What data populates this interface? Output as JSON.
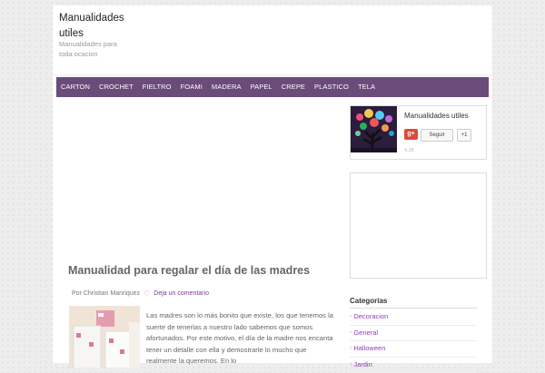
{
  "header": {
    "site_title": "Manualidades utiles",
    "site_description": "Manualidades para toda ocacion"
  },
  "nav": {
    "items": [
      "CARTON",
      "CROCHET",
      "FIELTRO",
      "FOAMI",
      "MADERA",
      "PAPEL",
      "CREPE",
      "PLASTICO",
      "TELA"
    ]
  },
  "post": {
    "title": "Manualidad para regalar el día de las madres",
    "author": "Por Christian Manriquez",
    "comment_link": "Deja un comentario",
    "excerpt": "Las madres son lo más bonito que existe, los que tenemos la suerte de tenerlas a nuestro lado sabemos que somos afortunados. Por este motivo, el día de la madre nos encanta tener un detalle con ella y demostrarle lo mucho que realmente la queremos. En lo"
  },
  "gplus_widget": {
    "page_name": "Manualidades utiles",
    "logo_text": "g+",
    "follow_label": "Seguir",
    "plus_one_label": "+1",
    "follower_count": "4.2K"
  },
  "categories": {
    "title": "Categorías",
    "items": [
      "Decoracion",
      "General",
      "Halloween",
      "Jardin"
    ]
  },
  "colors": {
    "nav_background": "#6b4b79",
    "link_color": "#8e3fbf",
    "gplus_red": "#dd4b39"
  }
}
